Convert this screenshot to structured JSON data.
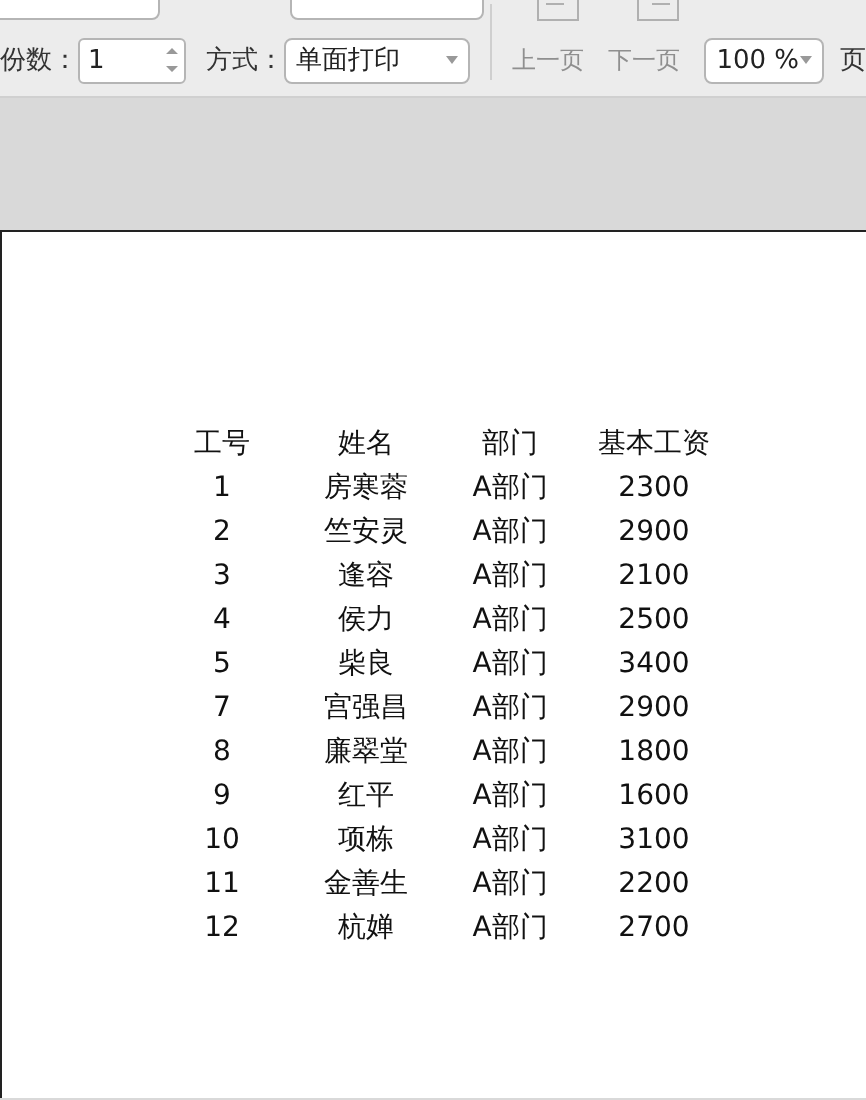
{
  "toolbar": {
    "copies": {
      "label": "份数：",
      "value": "1"
    },
    "mode": {
      "label": "方式：",
      "value": "单面打印"
    },
    "nav_buttons": [
      {
        "label": "上一页",
        "disabled": true
      },
      {
        "label": "下一页",
        "disabled": true
      }
    ],
    "zoom": {
      "value": "100 %"
    },
    "trailing_label": "页"
  },
  "sheet": {
    "columns": [
      "工号",
      "姓名",
      "部门",
      "基本工资"
    ],
    "rows": [
      [
        "1",
        "房寒蓉",
        "A部门",
        "2300"
      ],
      [
        "2",
        "竺安灵",
        "A部门",
        "2900"
      ],
      [
        "3",
        "逢容",
        "A部门",
        "2100"
      ],
      [
        "4",
        "侯力",
        "A部门",
        "2500"
      ],
      [
        "5",
        "柴良",
        "A部门",
        "3400"
      ],
      [
        "7",
        "宫强昌",
        "A部门",
        "2900"
      ],
      [
        "8",
        "廉翠堂",
        "A部门",
        "1800"
      ],
      [
        "9",
        "红平",
        "A部门",
        "1600"
      ],
      [
        "10",
        "项栋",
        "A部门",
        "3100"
      ],
      [
        "11",
        "金善生",
        "A部门",
        "2200"
      ],
      [
        "12",
        "杭婵",
        "A部门",
        "2700"
      ]
    ]
  }
}
